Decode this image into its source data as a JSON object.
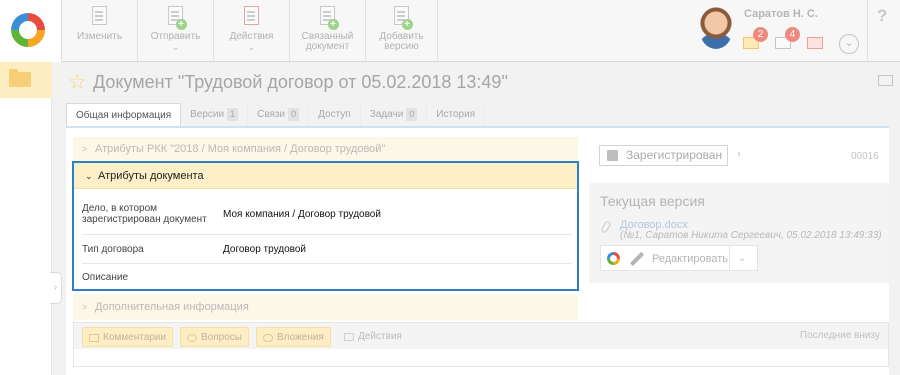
{
  "toolbar": {
    "buttons": [
      {
        "label_l1": "Изменить",
        "label_l2": "",
        "caret": ""
      },
      {
        "label_l1": "Отправить",
        "label_l2": "",
        "caret": "⌄"
      },
      {
        "label_l1": "Действия",
        "label_l2": "",
        "caret": "⌄"
      },
      {
        "label_l1": "Связанный",
        "label_l2": "документ",
        "caret": ""
      },
      {
        "label_l1": "Добавить",
        "label_l2": "версию",
        "caret": ""
      }
    ]
  },
  "user": {
    "name": "Саратов Н. С.",
    "mail_count": "2",
    "tasks_count": "4",
    "help": "?"
  },
  "document": {
    "title": "Документ \"Трудовой договор от 05.02.2018 13:49\""
  },
  "tabs": [
    {
      "label": "Общая информация",
      "count": ""
    },
    {
      "label": "Версии",
      "count": "1"
    },
    {
      "label": "Связи",
      "count": "0"
    },
    {
      "label": "Доступ",
      "count": ""
    },
    {
      "label": "Задачи",
      "count": "0"
    },
    {
      "label": "История",
      "count": ""
    }
  ],
  "sections": {
    "rkk": "Атрибуты РКК \"2018 / Моя компания / Договор трудовой\"",
    "attributes": "Атрибуты документа",
    "additional": "Дополнительная информация"
  },
  "attributes": [
    {
      "key_l1": "Дело, в котором",
      "key_l2": "зарегистрирован документ",
      "value": "Моя компания / Договор трудовой"
    },
    {
      "key_l1": "Тип договора",
      "key_l2": "",
      "value": "Договор трудовой"
    },
    {
      "key_l1": "Описание",
      "key_l2": "",
      "value": ""
    }
  ],
  "comments": {
    "buttons": [
      "Комментарии",
      "Вопросы",
      "Вложения",
      "Действия"
    ],
    "sort_label": "Последние внизу"
  },
  "registration": {
    "button": "Зарегистрирован",
    "number": "00016"
  },
  "current_version": {
    "title": "Текущая версия",
    "file_name": "Договор.docx",
    "file_meta": "(№1, Саратов Никита Сергеевич, 05.02.2018 13:49:33)",
    "edit_label": "Редактировать"
  }
}
